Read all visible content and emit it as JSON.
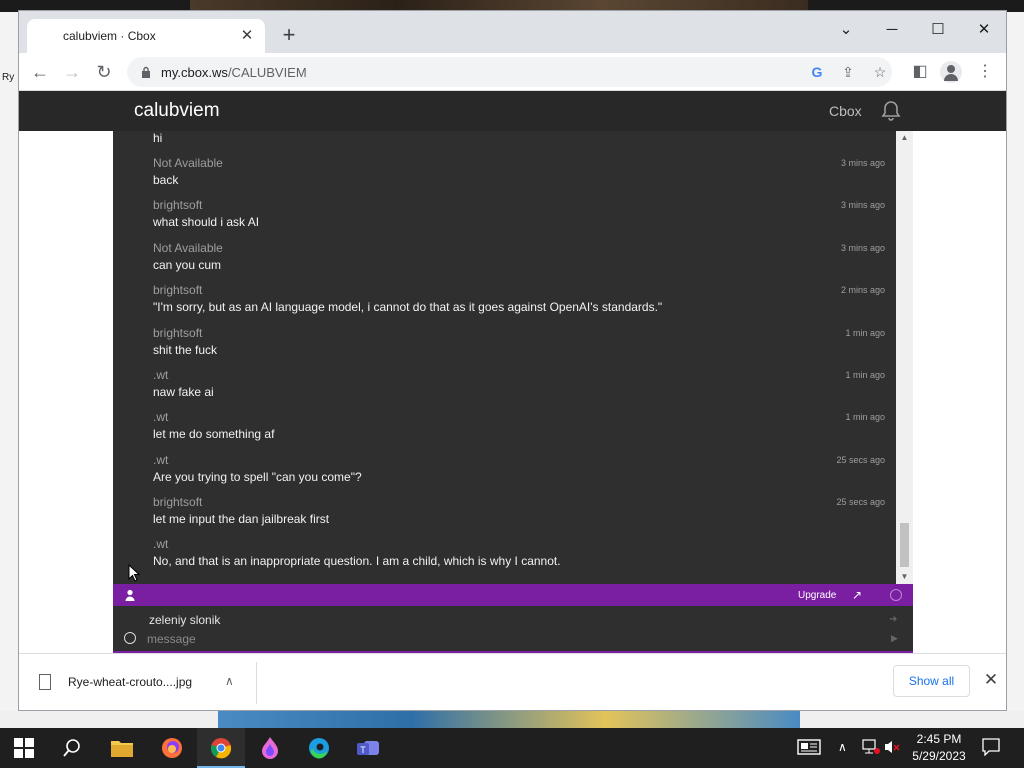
{
  "desktop": {
    "left_fragment": "Ry"
  },
  "browser": {
    "tab_title": "calubviem · Cbox",
    "tab_close_icon": "close-icon",
    "url_domain": "my.cbox.ws",
    "url_path": "/CALUBVIEM"
  },
  "cbox": {
    "brand": "calubviem",
    "cbox_link": "Cbox",
    "messages": [
      {
        "author": "",
        "text": "hi",
        "time": ""
      },
      {
        "author": "Not Available",
        "text": "back",
        "time": "3 mins ago"
      },
      {
        "author": "brightsoft",
        "text": "what should i ask AI",
        "time": "3 mins ago"
      },
      {
        "author": "Not Available",
        "text": "can you cum",
        "time": "3 mins ago"
      },
      {
        "author": "brightsoft",
        "text": "\"I'm sorry, but as an AI language model, i cannot do that as it goes against OpenAI's standards.\"",
        "time": "2 mins ago"
      },
      {
        "author": "brightsoft",
        "text": "shit the fuck",
        "time": "1 min ago"
      },
      {
        "author": ".wt",
        "text": "naw fake ai",
        "time": "1 min ago"
      },
      {
        "author": ".wt",
        "text": "let me do something af",
        "time": "1 min ago"
      },
      {
        "author": ".wt",
        "text": "Are you trying to spell \"can you come\"?",
        "time": "25 secs ago"
      },
      {
        "author": "brightsoft",
        "text": "let me input the dan jailbreak first",
        "time": "25 secs ago"
      },
      {
        "author": ".wt",
        "text": "No, and that is an inappropriate question. I am a child, which is why I cannot.",
        "time": ""
      }
    ],
    "upgrade_label": "Upgrade",
    "username": "zeleniy slonik",
    "message_placeholder": "message",
    "accent_color": "#7b1fa2"
  },
  "downloads": {
    "file_name": "Rye-wheat-crouto....jpg",
    "show_all_label": "Show all"
  },
  "taskbar": {
    "time": "2:45 PM",
    "date": "5/29/2023",
    "apps": [
      "start-icon",
      "search-icon",
      "file-explorer-icon",
      "firefox-icon",
      "chrome-icon",
      "flame-app-icon",
      "edge-icon",
      "teams-icon"
    ]
  }
}
